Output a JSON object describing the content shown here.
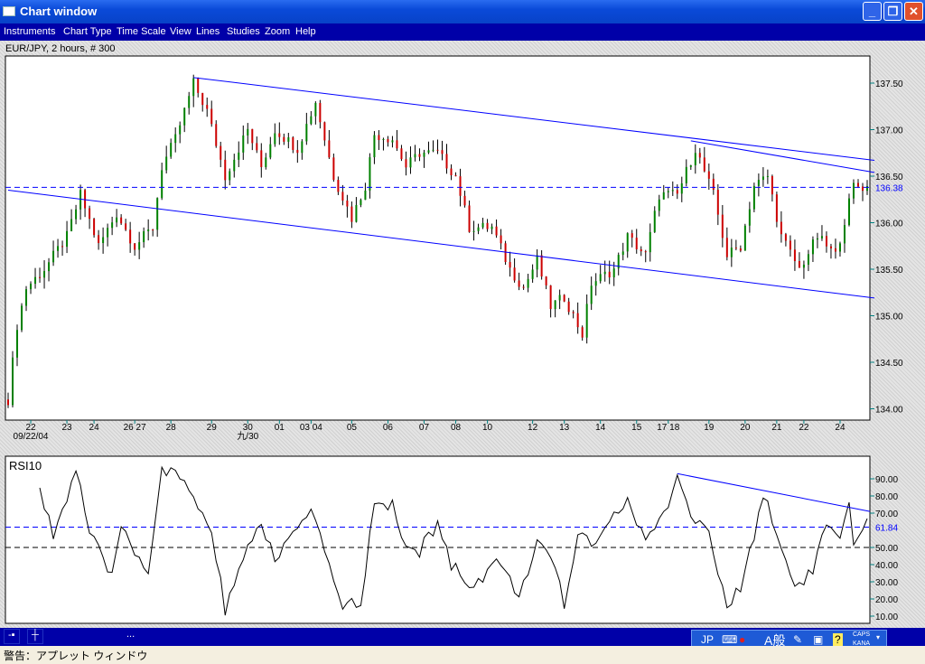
{
  "window": {
    "title": "Chart window",
    "minimize": "_",
    "restore": "❐",
    "close": "✕"
  },
  "menu": [
    "Instruments",
    "Chart Type",
    "Time Scale",
    "View",
    "Lines",
    "Studies",
    "Zoom",
    "Help"
  ],
  "chart_title": "EUR/JPY, 2 hours, # 300",
  "chart_data": [
    {
      "type": "candlestick",
      "title": "EUR/JPY, 2 hours, # 300",
      "ylim": [
        133.95,
        137.85
      ],
      "y_ticks": [
        "137.50",
        "137.00",
        "136.50",
        "136.00",
        "135.50",
        "135.00",
        "134.50",
        "134.00"
      ],
      "y_tick_values": [
        137.5,
        137.0,
        136.5,
        136.0,
        135.5,
        135.0,
        134.5,
        134.0
      ],
      "current_level": {
        "label": "136.38",
        "value": 136.38,
        "color": "#0000ff"
      },
      "x_ticks": [
        {
          "label": "22",
          "bar": 5
        },
        {
          "label": "23",
          "bar": 13
        },
        {
          "label": "24",
          "bar": 19
        },
        {
          "label": "26 27",
          "bar": 28
        },
        {
          "label": "28",
          "bar": 36
        },
        {
          "label": "29",
          "bar": 45
        },
        {
          "label": "30",
          "bar": 53
        },
        {
          "label": "01",
          "bar": 60
        },
        {
          "label": "03 04",
          "bar": 67
        },
        {
          "label": "05",
          "bar": 76
        },
        {
          "label": "06",
          "bar": 84
        },
        {
          "label": "07",
          "bar": 92
        },
        {
          "label": "08",
          "bar": 99
        },
        {
          "label": "10",
          "bar": 106
        },
        {
          "label": "12",
          "bar": 116
        },
        {
          "label": "13",
          "bar": 123
        },
        {
          "label": "14",
          "bar": 131
        },
        {
          "label": "15",
          "bar": 139
        },
        {
          "label": "17 18",
          "bar": 146
        },
        {
          "label": "19",
          "bar": 155
        },
        {
          "label": "20",
          "bar": 163
        },
        {
          "label": "21",
          "bar": 170
        },
        {
          "label": "22",
          "bar": 176
        },
        {
          "label": "24",
          "bar": 184
        }
      ],
      "x_sub_labels": [
        {
          "label": "09/22/04",
          "bar": 5
        },
        {
          "label": "九/30",
          "bar": 53
        }
      ],
      "bars": 191,
      "close_path": [
        [
          0,
          134.1
        ],
        [
          2,
          134.9
        ],
        [
          4,
          135.3
        ],
        [
          8,
          135.5
        ],
        [
          13,
          135.85
        ],
        [
          16,
          136.3
        ],
        [
          20,
          135.75
        ],
        [
          24,
          136.1
        ],
        [
          28,
          135.75
        ],
        [
          32,
          135.95
        ],
        [
          34,
          136.6
        ],
        [
          37,
          136.9
        ],
        [
          41,
          137.5
        ],
        [
          44,
          137.2
        ],
        [
          48,
          136.5
        ],
        [
          53,
          137.0
        ],
        [
          56,
          136.6
        ],
        [
          59,
          137.0
        ],
        [
          64,
          136.8
        ],
        [
          68,
          137.3
        ],
        [
          72,
          136.5
        ],
        [
          76,
          136.05
        ],
        [
          79,
          136.4
        ],
        [
          81,
          136.95
        ],
        [
          85,
          136.9
        ],
        [
          88,
          136.6
        ],
        [
          91,
          136.75
        ],
        [
          95,
          136.75
        ],
        [
          99,
          136.5
        ],
        [
          102,
          135.95
        ],
        [
          107,
          135.95
        ],
        [
          111,
          135.5
        ],
        [
          114,
          135.3
        ],
        [
          117,
          135.6
        ],
        [
          120,
          135.1
        ],
        [
          123,
          135.2
        ],
        [
          127,
          134.8
        ],
        [
          129,
          135.35
        ],
        [
          134,
          135.5
        ],
        [
          137,
          135.85
        ],
        [
          141,
          135.65
        ],
        [
          144,
          136.3
        ],
        [
          148,
          136.3
        ],
        [
          152,
          136.8
        ],
        [
          156,
          136.3
        ],
        [
          159,
          135.65
        ],
        [
          162,
          135.75
        ],
        [
          165,
          136.4
        ],
        [
          168,
          136.5
        ],
        [
          171,
          135.85
        ],
        [
          175,
          135.5
        ],
        [
          179,
          135.85
        ],
        [
          183,
          135.65
        ],
        [
          187,
          136.4
        ],
        [
          190,
          136.38
        ]
      ],
      "trendlines": [
        {
          "from": [
            41,
            137.56
          ],
          "to": [
            191,
            136.67
          ]
        },
        {
          "from": [
            151,
            136.88
          ],
          "to": [
            191,
            136.54
          ]
        },
        {
          "from": [
            0,
            136.35
          ],
          "to": [
            191,
            135.19
          ]
        }
      ],
      "colors": {
        "up": "#008000",
        "down": "#cc0000",
        "wick": "#000000",
        "trendline": "#0000ff"
      }
    },
    {
      "type": "line",
      "title": "RSI10",
      "ylim": [
        5,
        98
      ],
      "y_ticks": [
        "90.00",
        "80.00",
        "70.00",
        "60.00",
        "50.00",
        "40.00",
        "30.00",
        "20.00",
        "10.00"
      ],
      "y_tick_values": [
        90,
        80,
        70,
        60,
        50,
        40,
        30,
        20,
        10
      ],
      "current_level": {
        "label": "61.84",
        "value": 61.84,
        "color": "#0000ff"
      },
      "reference_level": 50,
      "path": [
        [
          7,
          85
        ],
        [
          10,
          58
        ],
        [
          13,
          79
        ],
        [
          15,
          96
        ],
        [
          18,
          58
        ],
        [
          23,
          32
        ],
        [
          25,
          64
        ],
        [
          28,
          48
        ],
        [
          31,
          37
        ],
        [
          34,
          95
        ],
        [
          37,
          92
        ],
        [
          41,
          80
        ],
        [
          45,
          58
        ],
        [
          48,
          14
        ],
        [
          51,
          37
        ],
        [
          56,
          64
        ],
        [
          59,
          43
        ],
        [
          63,
          58
        ],
        [
          67,
          69
        ],
        [
          70,
          48
        ],
        [
          74,
          16
        ],
        [
          78,
          19
        ],
        [
          81,
          74
        ],
        [
          85,
          74
        ],
        [
          87,
          53
        ],
        [
          91,
          48
        ],
        [
          95,
          64
        ],
        [
          98,
          40
        ],
        [
          103,
          27
        ],
        [
          108,
          43
        ],
        [
          113,
          22
        ],
        [
          117,
          53
        ],
        [
          121,
          37
        ],
        [
          123,
          16
        ],
        [
          126,
          58
        ],
        [
          129,
          53
        ],
        [
          134,
          69
        ],
        [
          137,
          77
        ],
        [
          141,
          53
        ],
        [
          145,
          69
        ],
        [
          148,
          92
        ],
        [
          151,
          69
        ],
        [
          155,
          58
        ],
        [
          159,
          14
        ],
        [
          162,
          27
        ],
        [
          165,
          58
        ],
        [
          167,
          82
        ],
        [
          170,
          58
        ],
        [
          174,
          27
        ],
        [
          178,
          37
        ],
        [
          181,
          64
        ],
        [
          184,
          53
        ],
        [
          186,
          74
        ],
        [
          187,
          49
        ],
        [
          190,
          64
        ],
        [
          191,
          62
        ]
      ],
      "trendline": {
        "from": [
          148,
          93
        ],
        "to": [
          191,
          71
        ]
      }
    }
  ],
  "taskbar": {
    "items": [
      "-▪",
      "┼",
      "..."
    ]
  },
  "ime": {
    "lang": "JP",
    "mode": "A般",
    "caps": "CAPS",
    "kana": "KANA",
    "help": "?"
  },
  "status": "警告：アプレット ウィンドウ"
}
